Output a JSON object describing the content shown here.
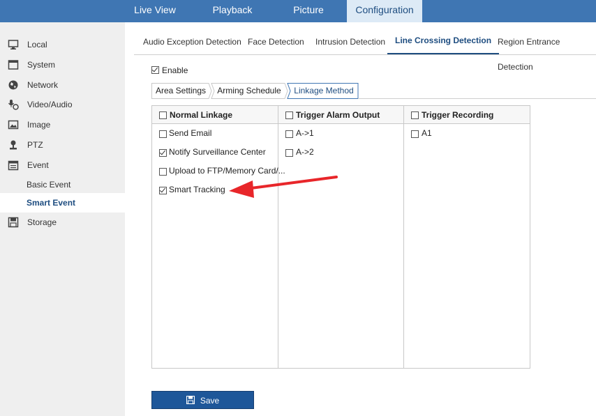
{
  "top_nav": [
    "Live View",
    "Playback",
    "Picture",
    "Configuration"
  ],
  "sidebar": {
    "items": [
      "Local",
      "System",
      "Network",
      "Video/Audio",
      "Image",
      "PTZ",
      "Event"
    ],
    "event_sub": [
      "Basic Event",
      "Smart Event"
    ],
    "storage": "Storage"
  },
  "tabs": [
    "Audio Exception Detection",
    "Face Detection",
    "Intrusion Detection",
    "Line Crossing Detection",
    "Region Entrance Detection"
  ],
  "enable_label": "Enable",
  "steps": [
    "Area Settings",
    "Arming Schedule",
    "Linkage Method"
  ],
  "table": {
    "headers": [
      "Normal Linkage",
      "Trigger Alarm Output",
      "Trigger Recording"
    ],
    "normal_linkage": [
      {
        "label": "Send Email",
        "checked": false
      },
      {
        "label": "Notify Surveillance Center",
        "checked": true
      },
      {
        "label": "Upload to FTP/Memory Card/...",
        "checked": false
      },
      {
        "label": "Smart Tracking",
        "checked": true
      }
    ],
    "alarm_outputs": [
      "A->1",
      "A->2"
    ],
    "recordings": [
      "A1"
    ]
  },
  "save_label": "Save",
  "colors": {
    "nav_bg": "#3f76b3",
    "accent": "#1e4d80",
    "arrow": "#e8262a"
  }
}
